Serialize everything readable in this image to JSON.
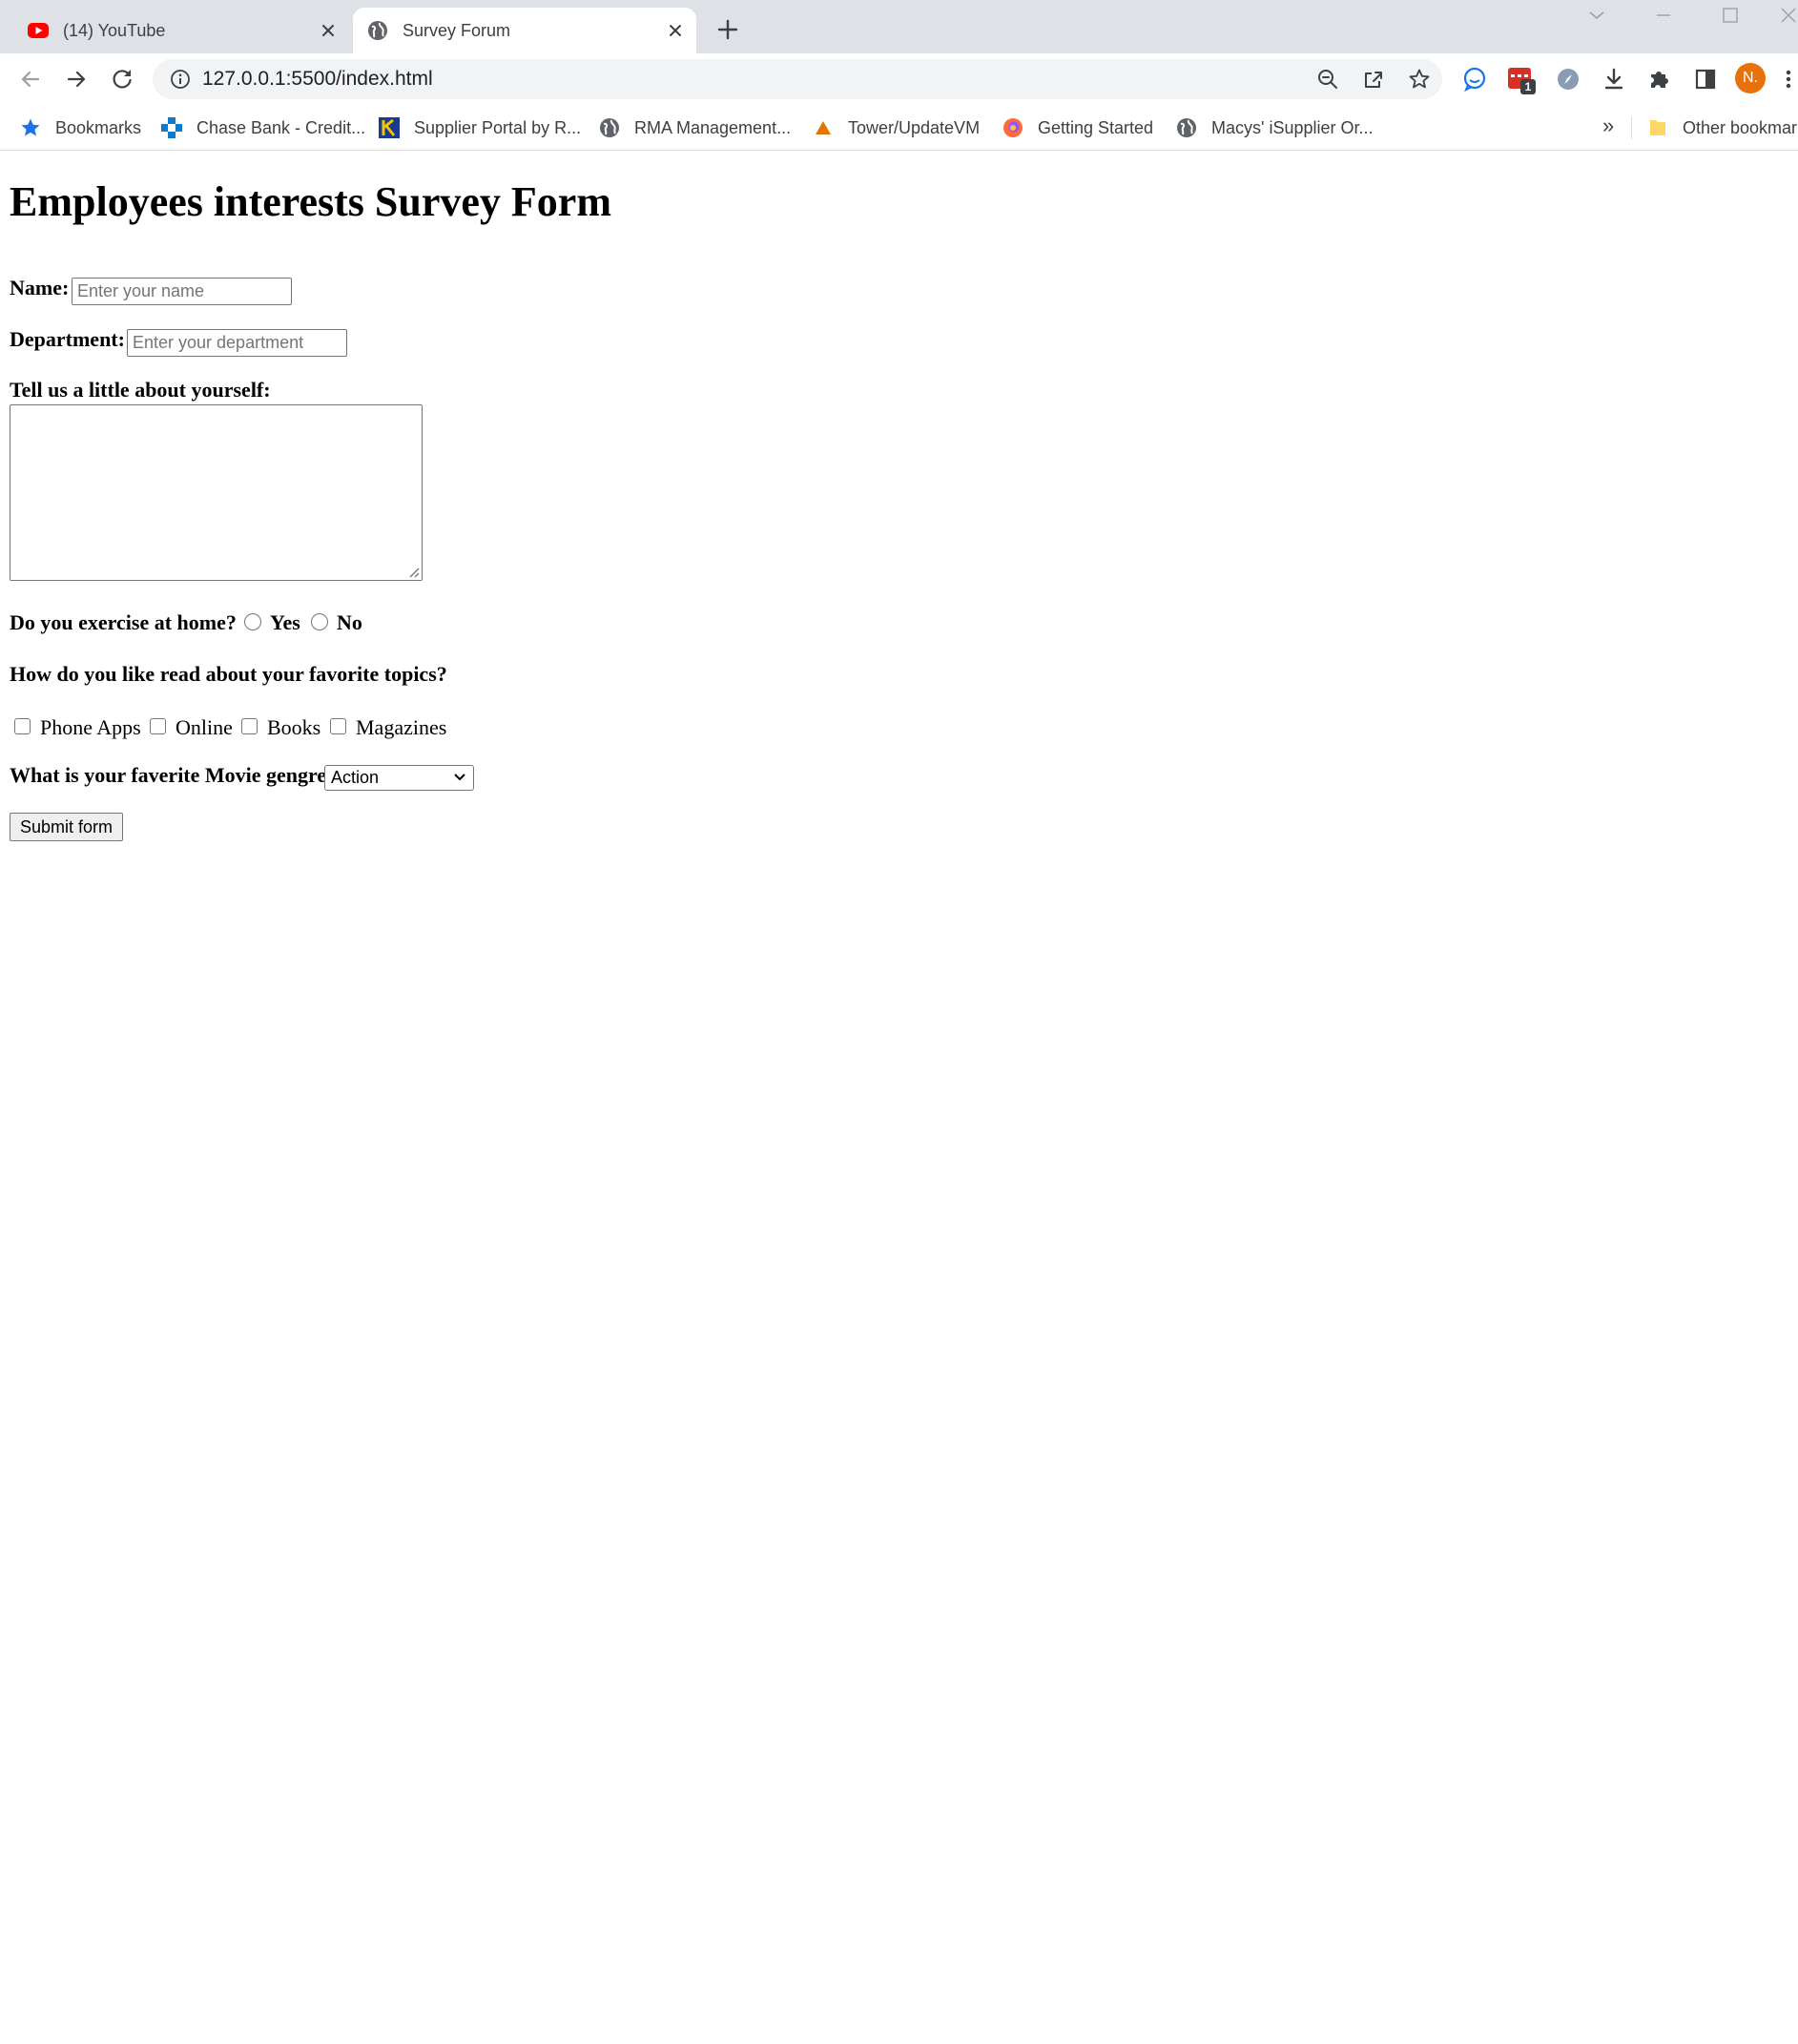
{
  "tabs": [
    {
      "title": "(14) YouTube",
      "icon": "youtube-icon",
      "active": false
    },
    {
      "title": "Survey Forum",
      "icon": "globe-icon",
      "active": true
    }
  ],
  "address_bar": {
    "url": "127.0.0.1:5500/index.html"
  },
  "profile": {
    "initial": "N.",
    "color": "#e8710a"
  },
  "extensions": {
    "badge_count": "1"
  },
  "bookmarks": {
    "items": [
      {
        "label": "Bookmarks",
        "icon": "star-icon"
      },
      {
        "label": "Chase Bank - Credit...",
        "icon": "chase-icon"
      },
      {
        "label": "Supplier Portal by R...",
        "icon": "k-icon"
      },
      {
        "label": "RMA Management...",
        "icon": "globe-icon"
      },
      {
        "label": "Tower/UpdateVM",
        "icon": "triangle-icon"
      },
      {
        "label": "Getting Started",
        "icon": "firefox-icon"
      },
      {
        "label": "Macys' iSupplier Or...",
        "icon": "globe-icon"
      }
    ],
    "overflow": "»",
    "other": {
      "label": "Other bookmarks",
      "icon": "folder-icon"
    }
  },
  "form": {
    "heading": "Employees interests Survey Form",
    "name": {
      "label": "Name:",
      "placeholder": "Enter your name"
    },
    "department": {
      "label": "Department:",
      "placeholder": "Enter your department"
    },
    "about": {
      "label": "Tell us a little about yourself:"
    },
    "exercise": {
      "question": "Do you exercise at home?",
      "options": [
        "Yes",
        "No"
      ]
    },
    "topics": {
      "question": "How do you like read about your favorite topics?",
      "options": [
        "Phone Apps",
        "Online",
        "Books",
        "Magazines"
      ]
    },
    "genre": {
      "question": "What is your faverite Movie gengre",
      "selected": "Action"
    },
    "submit_label": "Submit form"
  }
}
